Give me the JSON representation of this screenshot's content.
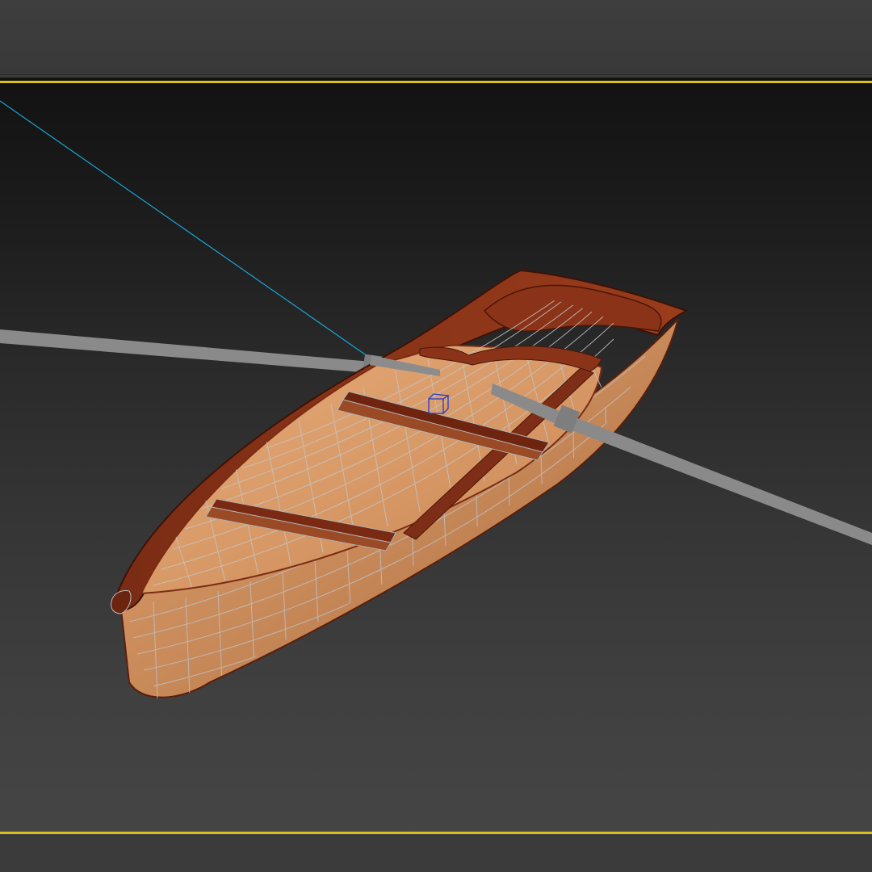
{
  "app": {
    "viewport": {
      "active_border_color": "#d8c21a",
      "background_top": "#121212",
      "background_bottom": "#454545"
    },
    "scene": {
      "object": "rowboat",
      "hull_outer_color": "#c98a5a",
      "hull_inner_color": "#d89a68",
      "gunwale_color": "#6b2410",
      "wireframe_color": "#b9b9b9",
      "oar_color": "#8a8a8a",
      "camera_line_color": "#1aa3d6",
      "gizmo_color": "#2a39c8"
    }
  }
}
